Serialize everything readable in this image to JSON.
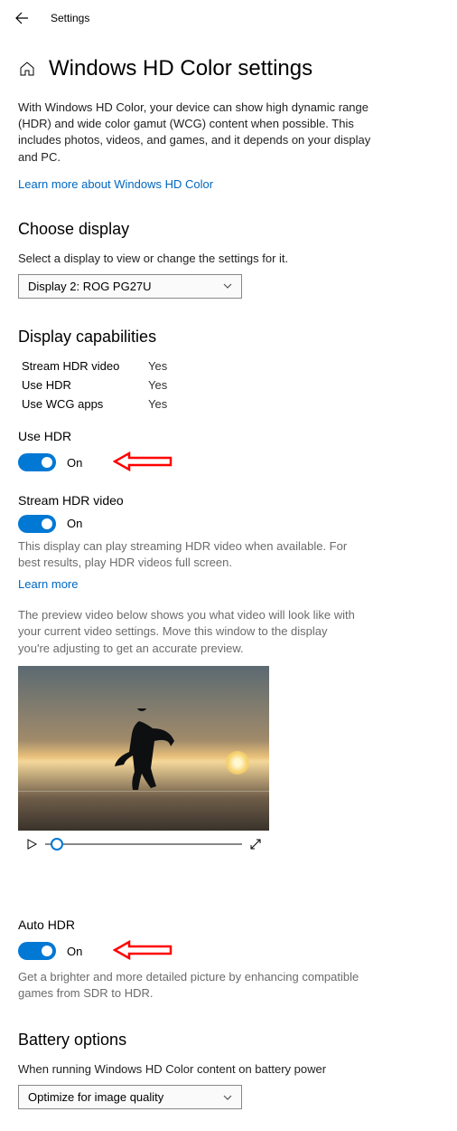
{
  "topbar": {
    "title": "Settings"
  },
  "page": {
    "title": "Windows HD Color settings",
    "intro": "With Windows HD Color, your device can show high dynamic range (HDR) and wide color gamut (WCG) content when possible. This includes photos, videos, and games, and it depends on your display and PC.",
    "learn_more": "Learn more about Windows HD Color"
  },
  "choose_display": {
    "heading": "Choose display",
    "instruction": "Select a display to view or change the settings for it.",
    "selected": "Display 2: ROG PG27U"
  },
  "capabilities": {
    "heading": "Display capabilities",
    "rows": [
      {
        "label": "Stream HDR video",
        "value": "Yes"
      },
      {
        "label": "Use HDR",
        "value": "Yes"
      },
      {
        "label": "Use WCG apps",
        "value": "Yes"
      }
    ]
  },
  "use_hdr": {
    "label": "Use HDR",
    "state": "On"
  },
  "stream_hdr": {
    "label": "Stream HDR video",
    "state": "On",
    "hint": "This display can play streaming HDR video when available. For best results, play HDR videos full screen.",
    "learn_more": "Learn more",
    "preview_hint": "The preview video below shows you what video will look like with your current video settings. Move this window to the display you're adjusting to get an accurate preview."
  },
  "auto_hdr": {
    "label": "Auto HDR",
    "state": "On",
    "hint": "Get a brighter and more detailed picture by enhancing compatible games from SDR to HDR."
  },
  "battery": {
    "heading": "Battery options",
    "instruction": "When running Windows HD Color content on battery power",
    "selected": "Optimize for image quality"
  },
  "colors": {
    "accent": "#0078d4",
    "link": "#0067c0",
    "annotation": "#ff0000"
  }
}
